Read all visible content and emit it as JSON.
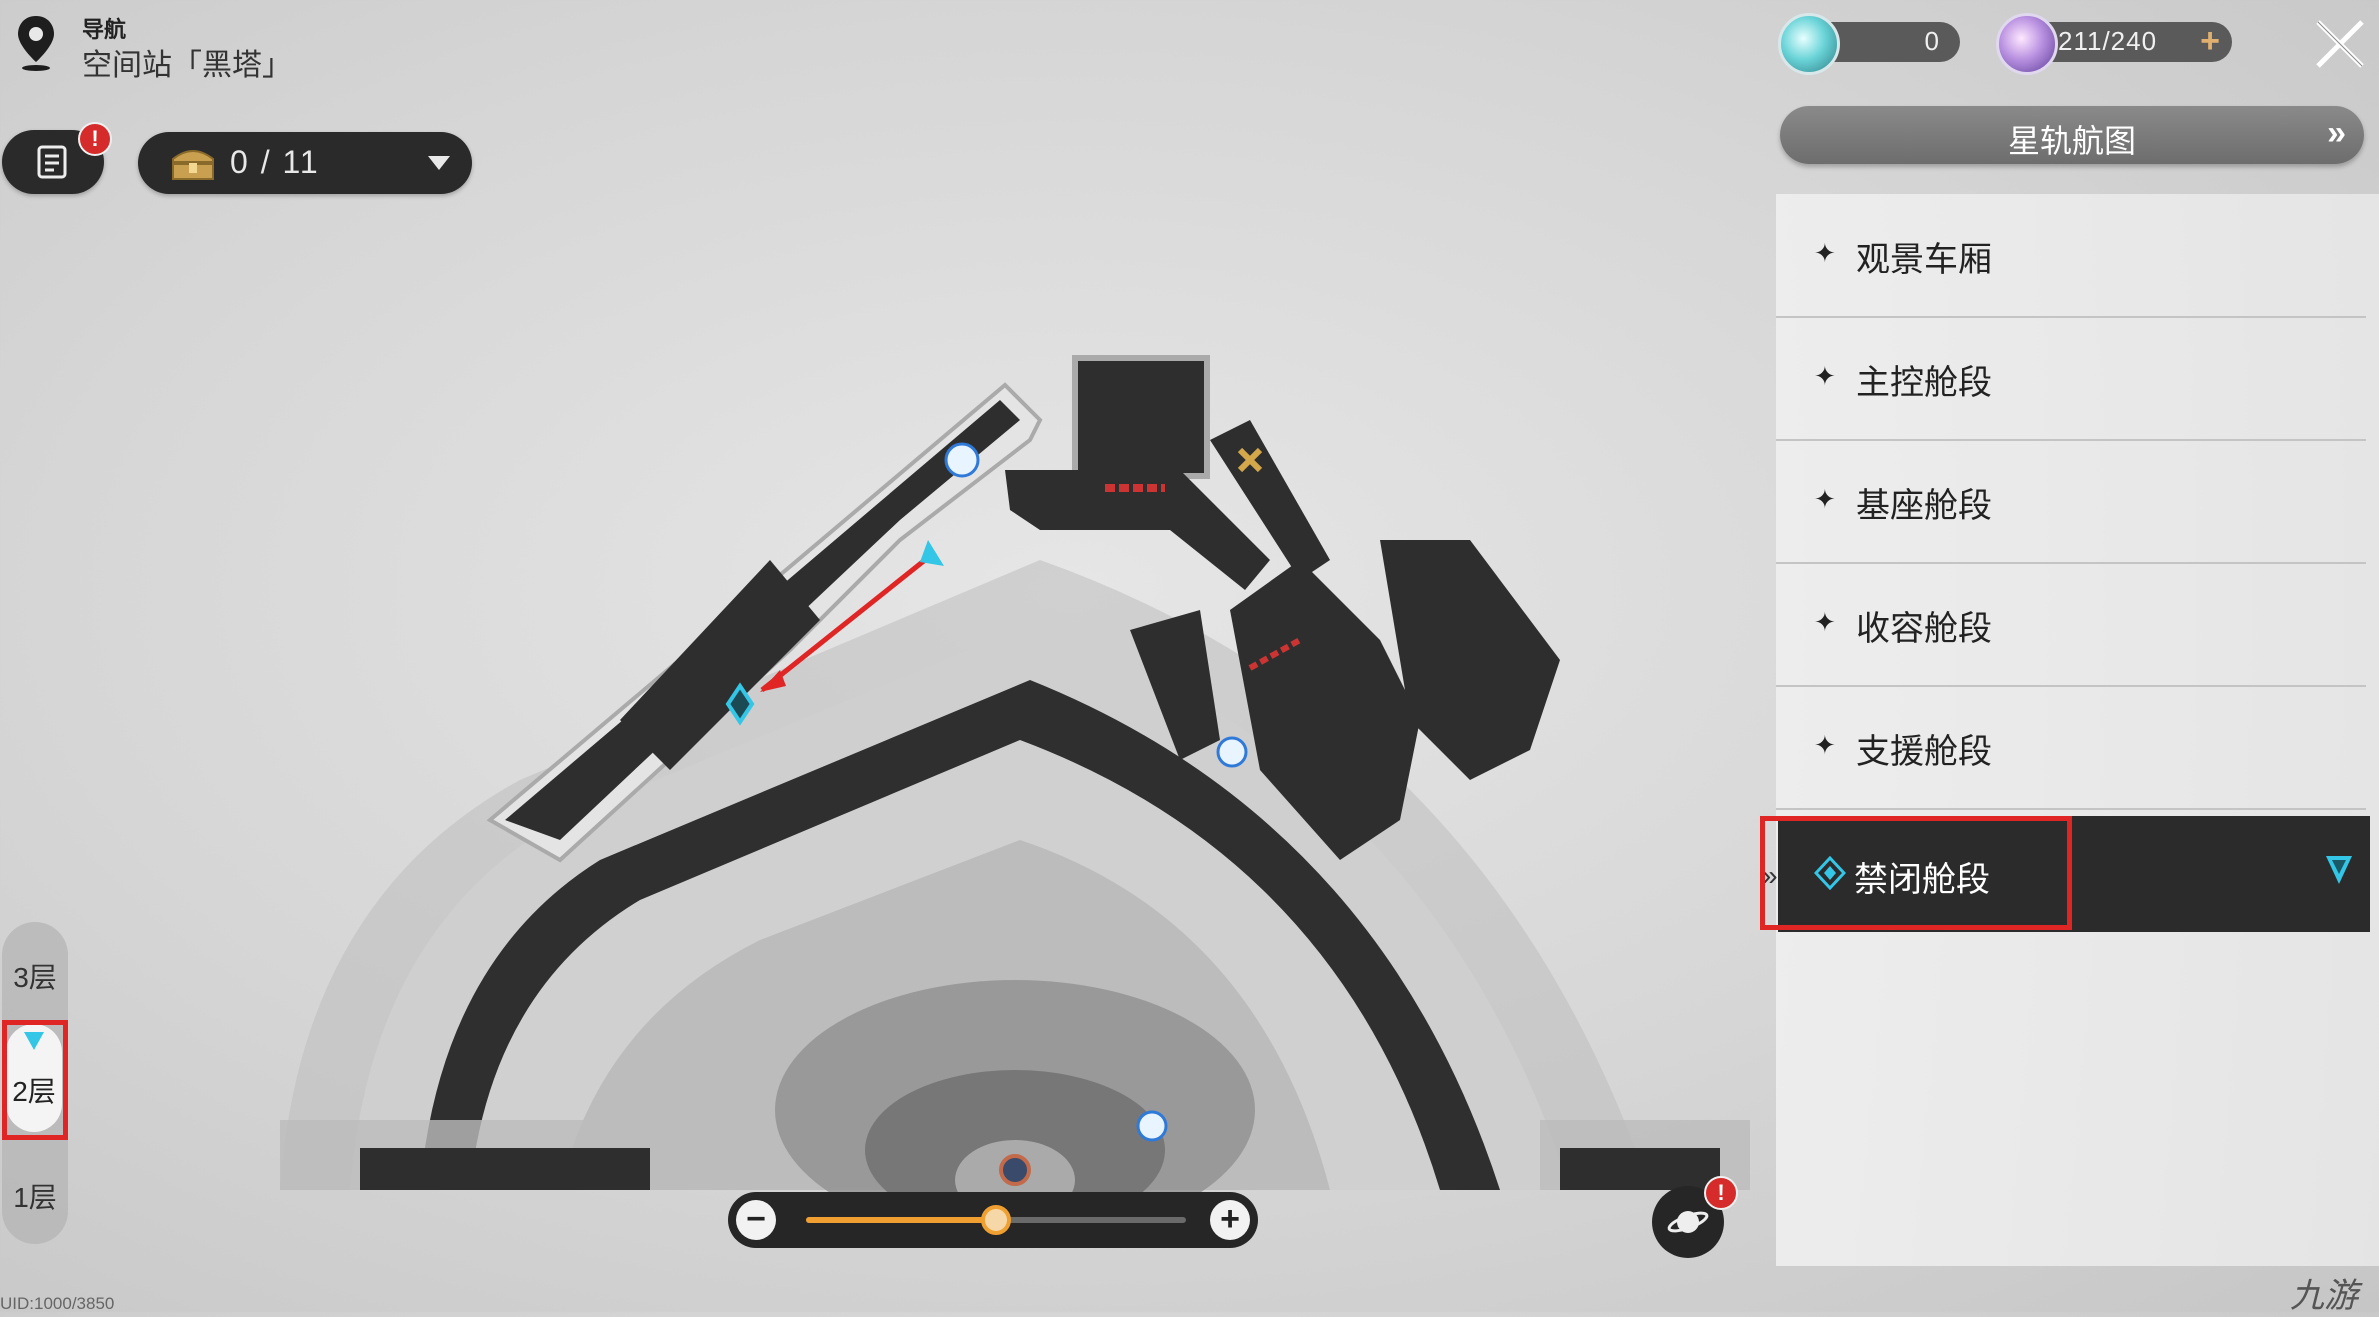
{
  "header": {
    "nav_title": "导航",
    "location": "空间站「黑塔」"
  },
  "toolbar": {
    "notes_badge": "!",
    "chest_count": "0 / 11"
  },
  "resources": {
    "currency_a": "0",
    "currency_b": "211/240",
    "plus_label": "+"
  },
  "star_rail_button": {
    "label": "星轨航图",
    "arrows": "»"
  },
  "sections": [
    {
      "label": "观景车厢"
    },
    {
      "label": "主控舱段"
    },
    {
      "label": "基座舱段"
    },
    {
      "label": "收容舱段"
    },
    {
      "label": "支援舱段"
    },
    {
      "label": "禁闭舱段",
      "active": true
    }
  ],
  "floors": [
    {
      "label": "3层"
    },
    {
      "label": "2层",
      "active": true
    },
    {
      "label": "1层"
    }
  ],
  "zoom": {
    "minus": "−",
    "plus": "+",
    "level": 0.5
  },
  "planet_badge": "!",
  "uid": "UID:1000/3850",
  "watermark": "九游",
  "colors": {
    "accent_red": "#e02525",
    "zoom_orange": "#f0a030",
    "marker_cyan": "#33c6e6",
    "dark_panel": "#2b2b2b"
  },
  "icons": [
    "map-pin-icon",
    "notes-icon",
    "chest-icon",
    "dropdown-arrow-icon",
    "close-icon",
    "planet-icon",
    "diamond-waypoint-icon",
    "player-arrow-icon"
  ]
}
